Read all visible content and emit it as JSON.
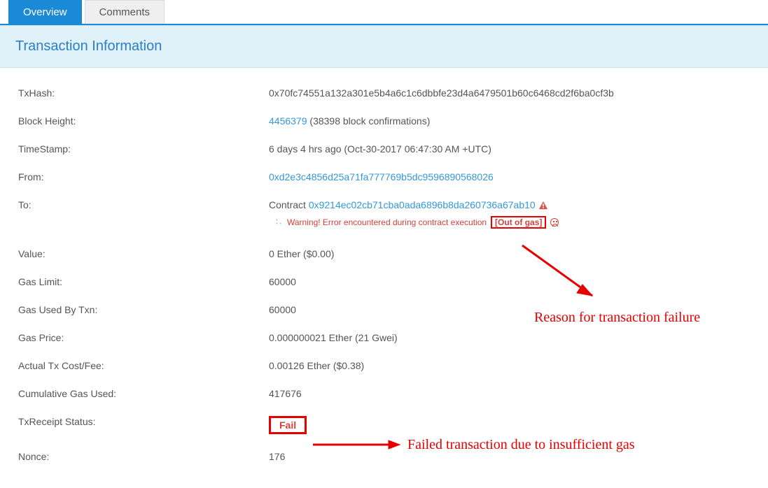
{
  "tabs": {
    "overview": "Overview",
    "comments": "Comments"
  },
  "panel": {
    "title": "Transaction Information"
  },
  "labels": {
    "txhash": "TxHash:",
    "blockheight": "Block Height:",
    "timestamp": "TimeStamp:",
    "from": "From:",
    "to": "To:",
    "value": "Value:",
    "gaslimit": "Gas Limit:",
    "gasused": "Gas Used By Txn:",
    "gasprice": "Gas Price:",
    "costfee": "Actual Tx Cost/Fee:",
    "cumgas": "Cumulative Gas Used:",
    "receipt": "TxReceipt Status:",
    "nonce": "Nonce:"
  },
  "tx": {
    "hash": "0x70fc74551a132a301e5b4a6c1c6dbbfe23d4a6479501b60c6468cd2f6ba0cf3b",
    "block": "4456379",
    "block_conf": "(38398 block confirmations)",
    "timestamp": "6 days 4 hrs ago (Oct-30-2017 06:47:30 AM +UTC)",
    "from": "0xd2e3c4856d25a71fa777769b5dc9596890568026",
    "to_prefix": "Contract ",
    "to": "0x9214ec02cb71cba0ada6896b8da260736a67ab10",
    "warn_text": "Warning! Error encountered during contract execution ",
    "warn_reason": "[Out of gas]",
    "value": "0 Ether ($0.00)",
    "gas_limit": "60000",
    "gas_used": "60000",
    "gas_price": "0.000000021 Ether (21 Gwei)",
    "cost_fee": "0.00126 Ether ($0.38)",
    "cum_gas": "417676",
    "receipt_status": "Fail",
    "nonce": "176"
  },
  "annotations": {
    "reason": "Reason for transaction failure",
    "failed": "Failed transaction due to insufficient gas"
  }
}
